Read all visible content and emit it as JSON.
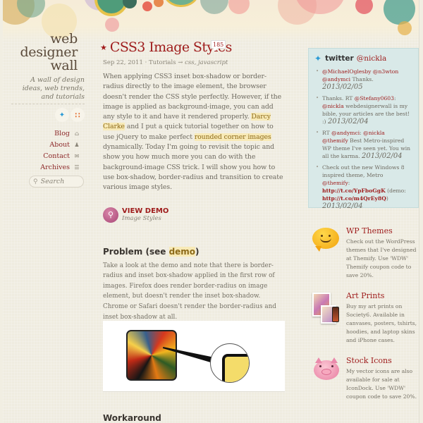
{
  "site": {
    "logo_lines": [
      "web",
      "designer",
      "wall"
    ],
    "tagline": "A wall of design ideas, web trends, and tutorials",
    "social": [
      {
        "name": "twitter",
        "icon": "twitter-bird-icon",
        "glyph": "🐦"
      },
      {
        "name": "rss",
        "icon": "rss-icon",
        "glyph": "◉"
      }
    ],
    "nav": [
      {
        "label": "Blog",
        "icon": "home-icon",
        "glyph": "⌂"
      },
      {
        "label": "About",
        "icon": "person-icon",
        "glyph": "♟"
      },
      {
        "label": "Contact",
        "icon": "mail-icon",
        "glyph": "✉"
      },
      {
        "label": "Archives",
        "icon": "list-icon",
        "glyph": "☰"
      }
    ],
    "search": {
      "placeholder": "Search",
      "icon": "search-icon"
    }
  },
  "post": {
    "title": "CSS3 Image Styles",
    "comment_count": "185",
    "date": "Sep 22, 2011",
    "category": "Tutorials",
    "tags": "css, javascript",
    "intro_parts": {
      "p1": "When applying CSS3 inset box-shadow or border-radius directly to the image element, the browser doesn't render the CSS style perfectly. However, if the image is applied as background-image, you can add any style to it and have it rendered properly. ",
      "link1": "Darcy Clarke",
      "p2": " and I put a quick tutorial together on how to use jQuery to make perfect ",
      "link2": "rounded corner images",
      "p3": " dynamically. Today I'm going to revisit the topic and show you how much more you can do with the background-image CSS trick. I will show you how to use box-shadow, border-radius and transition to create various image styles."
    },
    "demo_button": {
      "label": "VIEW DEMO",
      "sub": "Image Styles"
    },
    "problem_heading": {
      "pre": "Problem (see ",
      "link": "demo",
      "post": ")"
    },
    "problem_text": "Take a look at the demo and note that there is border-radius and inset box-shadow applied in the first row of images. Firefox does render border-radius on image element, but doesn't render the inset box-shadow. Chrome or Safari doesn't render the border-radius and inset box-shadow at all.",
    "workaround_heading": "Workaround"
  },
  "twitter": {
    "label": "twitter",
    "handle": "@nickla",
    "tweets": [
      {
        "parts": [
          {
            "t": "@MichaelOglesby",
            "k": "u"
          },
          {
            "t": " "
          },
          {
            "t": "@n3wton",
            "k": "u"
          },
          {
            "t": " "
          },
          {
            "t": "@andymci",
            "k": "u"
          },
          {
            "t": " Thanks. "
          },
          {
            "t": "2013/02/05",
            "k": "date"
          }
        ]
      },
      {
        "parts": [
          {
            "t": "Thanks. RT "
          },
          {
            "t": "@Stefany0603",
            "k": "u"
          },
          {
            "t": ": "
          },
          {
            "t": "@nickla",
            "k": "u"
          },
          {
            "t": " webdesignerwall is my bible, your articles are the best! :) "
          },
          {
            "t": "2013/02/04",
            "k": "date"
          }
        ]
      },
      {
        "parts": [
          {
            "t": "RT "
          },
          {
            "t": "@andymci",
            "k": "u"
          },
          {
            "t": ": "
          },
          {
            "t": "@nickla",
            "k": "u"
          },
          {
            "t": " "
          },
          {
            "t": "@themify",
            "k": "u"
          },
          {
            "t": " Best Metro-inspired WP theme I've seen yet. You win all the karma. "
          },
          {
            "t": "2013/02/04",
            "k": "date"
          }
        ]
      },
      {
        "parts": [
          {
            "t": "Check out the new Windows 8 inspired theme, Metro "
          },
          {
            "t": "@themify",
            "k": "u"
          },
          {
            "t": ": "
          },
          {
            "t": "http://t.co/YpFboGgK",
            "k": "lnk"
          },
          {
            "t": " (demo: "
          },
          {
            "t": "http://t.co/m4QrEy8Q",
            "k": "lnk"
          },
          {
            "t": ") "
          },
          {
            "t": "2013/02/04",
            "k": "date"
          }
        ]
      }
    ]
  },
  "promos": [
    {
      "title": "WP Themes",
      "desc": "Check out the WordPress themes that I've designed at Themify. Use 'WDW' Themify coupon code to save 20%.",
      "icon": "smiley-speech-bubble-icon"
    },
    {
      "title": "Art Prints",
      "desc": "Buy my art prints on Society6. Available in canvases, posters, tshirts, hoodies, and laptop skins and iPhone cases.",
      "icon": "art-prints-icon"
    },
    {
      "title": "Stock Icons",
      "desc": "My vector icons are also available for sale at IconDock. Use 'WDW' coupon code to save 20%.",
      "icon": "piggy-bank-icon"
    }
  ],
  "colors": {
    "accent_red": "#9e1b1b",
    "highlight": "#f8eab7",
    "twitter_box": "#d9e9e8",
    "background": "#efece0"
  }
}
